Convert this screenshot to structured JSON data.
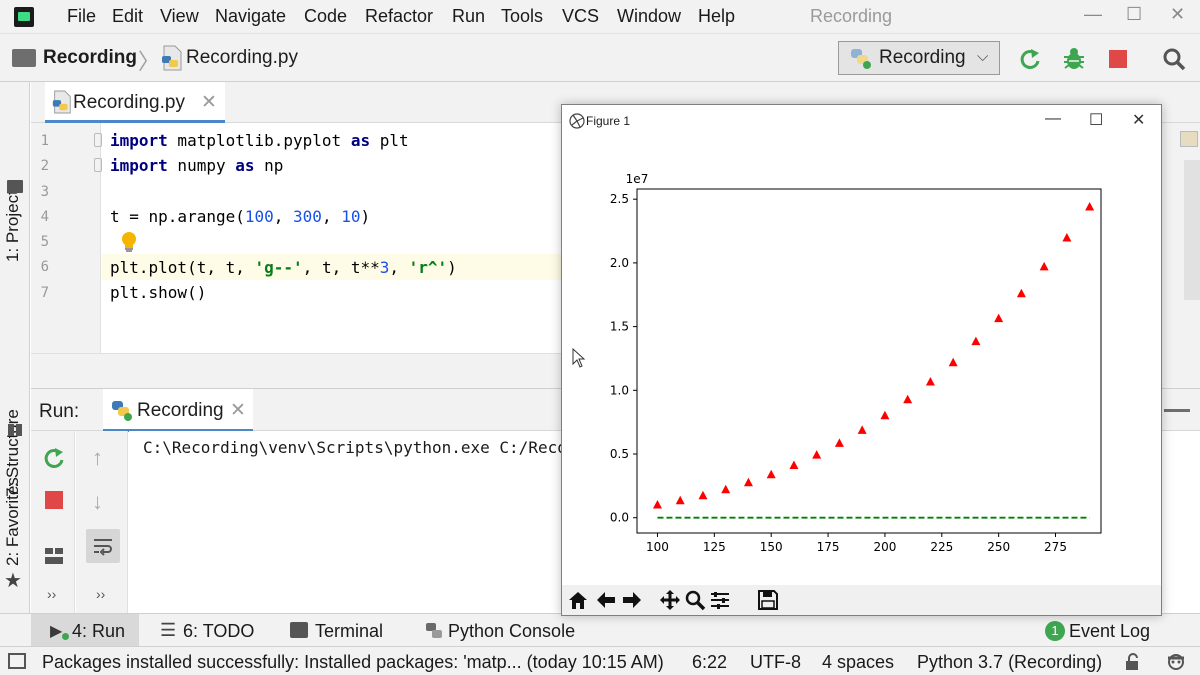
{
  "menu": {
    "items": [
      "File",
      "Edit",
      "View",
      "Navigate",
      "Code",
      "Refactor",
      "Run",
      "Tools",
      "VCS",
      "Window",
      "Help"
    ],
    "window_title": "Recording",
    "min": "—",
    "max": "☐",
    "close": "✕"
  },
  "nav": {
    "project": "Recording",
    "separator": "〉",
    "file": "Recording.py",
    "run_config": "Recording"
  },
  "left_tabs": {
    "project": "1: Project",
    "structure": "7: Structure",
    "favorites": "2: Favorites"
  },
  "editor": {
    "tab": "Recording.py",
    "close": "✕",
    "line_numbers": [
      "1",
      "2",
      "3",
      "4",
      "5",
      "6",
      "7"
    ],
    "lines": {
      "l1_kw1": "import",
      "l1_mod": " matplotlib.pyplot ",
      "l1_kw2": "as",
      "l1_alias": " plt",
      "l2_kw1": "import",
      "l2_mod": " numpy ",
      "l2_kw2": "as",
      "l2_alias": " np",
      "l4_a": "t = np.arange(",
      "l4_n1": "100",
      "l4_c1": ", ",
      "l4_n2": "300",
      "l4_c2": ", ",
      "l4_n3": "10",
      "l4_end": ")",
      "l6_a": "plt.plot(t, t, ",
      "l6_s1": "'g--'",
      "l6_b": ", t, t**",
      "l6_n": "3",
      "l6_c": ", ",
      "l6_s2": "'r^'",
      "l6_end": ")",
      "l7": "plt.show()"
    }
  },
  "run_panel": {
    "title": "Run:",
    "tab": "Recording",
    "close": "✕",
    "console_line": "C:\\Recording\\venv\\Scripts\\python.exe C:/Recor",
    "more1": "››",
    "more2": "››"
  },
  "tool_tabs": {
    "run": "4: Run",
    "todo": "6: TODO",
    "terminal": "Terminal",
    "python_console": "Python Console",
    "event_log": "Event Log",
    "event_count": "1"
  },
  "status": {
    "message": "Packages installed successfully: Installed packages: 'matp... (today 10:15 AM)",
    "position": "6:22",
    "encoding": "UTF-8",
    "indent": "4 spaces",
    "interpreter": "Python 3.7 (Recording)"
  },
  "figure": {
    "title": "Figure 1",
    "min": "—",
    "max": "☐",
    "close": "✕"
  },
  "colors": {
    "accent": "#4a88c7",
    "run_green": "#3ea650",
    "stop_red": "#e04848",
    "marker_red": "#ff0000",
    "line_green": "#008000"
  },
  "chart_data": {
    "type": "line",
    "title": "",
    "xlabel": "",
    "ylabel": "",
    "xlim": [
      91,
      295
    ],
    "ylim": [
      -1200000,
      25800000
    ],
    "y_offset_label": "1e7",
    "xticks": [
      100,
      125,
      150,
      175,
      200,
      225,
      250,
      275
    ],
    "xtick_labels": [
      "100",
      "125",
      "150",
      "175",
      "200",
      "225",
      "250",
      "275"
    ],
    "yticks": [
      0,
      5000000,
      10000000,
      15000000,
      20000000,
      25000000
    ],
    "ytick_labels": [
      "0.0",
      "0.5",
      "1.0",
      "1.5",
      "2.0",
      "2.5"
    ],
    "grid": false,
    "x": [
      100,
      110,
      120,
      130,
      140,
      150,
      160,
      170,
      180,
      190,
      200,
      210,
      220,
      230,
      240,
      250,
      260,
      270,
      280,
      290
    ],
    "series": [
      {
        "style": "dashed",
        "marker": "none",
        "color": "#008000",
        "values": [
          100,
          110,
          120,
          130,
          140,
          150,
          160,
          170,
          180,
          190,
          200,
          210,
          220,
          230,
          240,
          250,
          260,
          270,
          280,
          290
        ]
      },
      {
        "style": "none",
        "marker": "triangle-up",
        "color": "#ff0000",
        "values": [
          1000000,
          1331000,
          1728000,
          2197000,
          2744000,
          3375000,
          4096000,
          4913000,
          5832000,
          6859000,
          8000000,
          9261000,
          10648000,
          12167000,
          13824000,
          15625000,
          17576000,
          19683000,
          21952000,
          24389000
        ]
      }
    ]
  }
}
